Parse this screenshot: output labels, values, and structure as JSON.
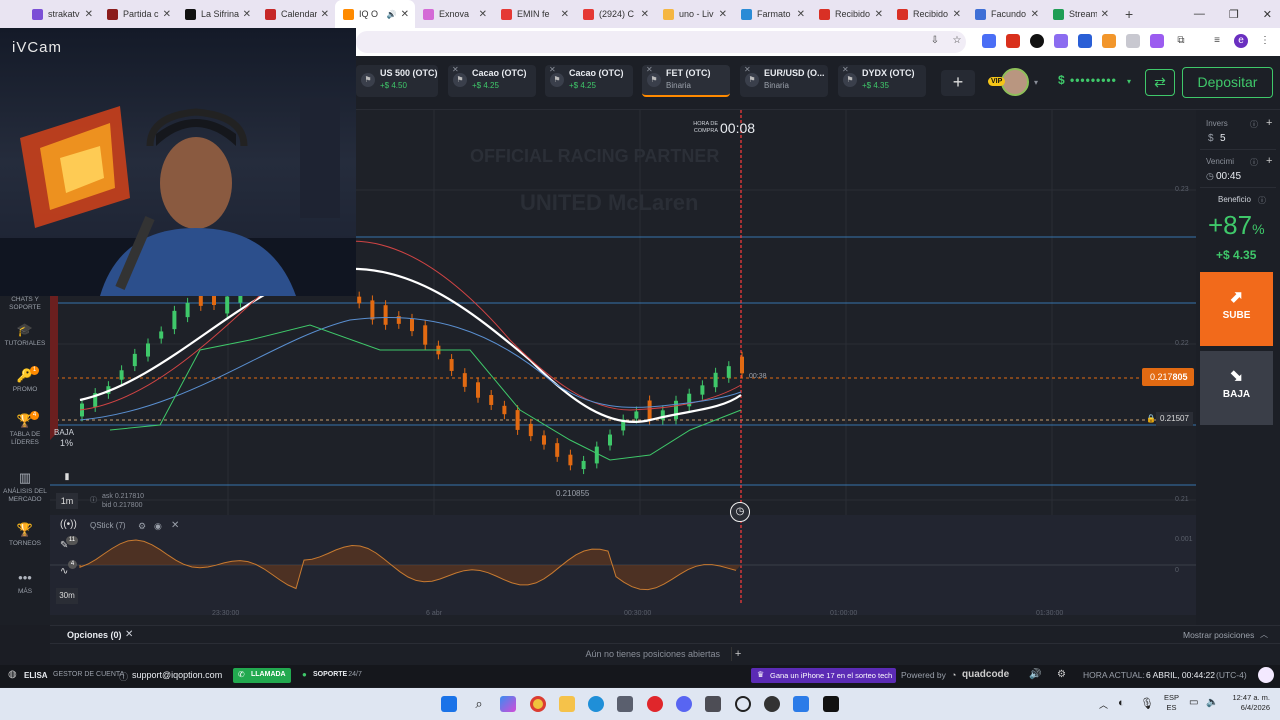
{
  "browser": {
    "tabs": [
      {
        "label": "strakatv",
        "color": "#7b4fd6"
      },
      {
        "label": "Partida c",
        "color": "#8b1c1c"
      },
      {
        "label": "La Sifrina",
        "color": "#111111"
      },
      {
        "label": "Calendar",
        "color": "#c62828"
      },
      {
        "label": "IQ O",
        "color": "#ff8a00",
        "active": true
      },
      {
        "label": "Exnova",
        "color": "#d46ad6"
      },
      {
        "label": "EMIN fe",
        "color": "#e53935"
      },
      {
        "label": "(2924) C",
        "color": "#e53935"
      },
      {
        "label": "uno - Liv",
        "color": "#f5b642"
      },
      {
        "label": "Farmato",
        "color": "#2a8bd6"
      },
      {
        "label": "Recibido",
        "color": "#d93025"
      },
      {
        "label": "Recibido",
        "color": "#d93025"
      },
      {
        "label": "Facundo",
        "color": "#3f6fd6"
      },
      {
        "label": "Stream",
        "color": "#1f9d55"
      }
    ],
    "new_tab": "+"
  },
  "webcam": {
    "title": "iVCam"
  },
  "assets": [
    {
      "name": "US 500 (OTC)",
      "sub": "+$ 4.50"
    },
    {
      "name": "Cacao (OTC)",
      "sub": "+$ 4.25"
    },
    {
      "name": "Cacao (OTC)",
      "sub": "+$ 4.25"
    },
    {
      "name": "FET (OTC)",
      "sub": "Binaria",
      "selected": true
    },
    {
      "name": "EUR/USD (O...",
      "sub": "Binaria"
    },
    {
      "name": "DYDX (OTC)",
      "sub": "+$ 4.35"
    }
  ],
  "header": {
    "vip": "VIP",
    "balance": "$ •••••••••",
    "deposit_label": "Depositar"
  },
  "sidebar": {
    "items": [
      {
        "label": "CHATS Y SOPORTE",
        "icon": "chat-icon"
      },
      {
        "label": "TUTORIALES",
        "icon": "graduation-cap-icon"
      },
      {
        "label": "PROMO",
        "icon": "promo-icon",
        "badge": "1"
      },
      {
        "label": "TABLA DE LÍDERES",
        "icon": "leaderboard-icon",
        "badge": "4"
      },
      {
        "label": "ANÁLISIS DEL MERCADO",
        "icon": "market-analysis-icon"
      },
      {
        "label": "TORNEOS",
        "icon": "trophy-icon"
      },
      {
        "label": "MÁS",
        "icon": "more-icon"
      }
    ]
  },
  "chart": {
    "purchase_time_label": "HORA DE COMPRA",
    "purchase_timer": "00:08",
    "expiry_timer": "00:38",
    "current_price_prefix": "0.217",
    "current_price_suffix": "805",
    "strike_price": "0.21507",
    "low_label": "0.210855",
    "ask": "ask 0.217810",
    "bid": "bid 0.217800",
    "baja_label": "BAJA",
    "baja_pct": "1%",
    "timeframe": "1m",
    "timeframe2": "30m",
    "indicator": "QStick (7)",
    "indicator_badge": "11",
    "indicator_badge2": "4",
    "right_axis": [
      "0.23",
      "0.22",
      "0.21",
      "0.001",
      "0"
    ],
    "x_axis": [
      "23:30:00",
      "6 abr",
      "00:30:00",
      "01:00:00",
      "01:30:00"
    ]
  },
  "rpanel": {
    "inversion_label": "Invers",
    "inversion_currency": "$",
    "inversion_value": "5",
    "vencimiento_label": "Vencimi",
    "vencimiento_value": "00:45",
    "beneficio_label": "Beneficio",
    "beneficio_pct": "+87",
    "beneficio_pct_suffix": "%",
    "beneficio_amount": "+$ 4.35",
    "sube_label": "SUBE",
    "baja_label": "BAJA"
  },
  "bottom": {
    "opciones_label": "Opciones (0)",
    "mostrar_label": "Mostrar posiciones",
    "empty_text": "Aún no tienes posiciones abiertas",
    "add": "+"
  },
  "status": {
    "user": "ELISA",
    "manager": "GESTOR DE CUENTA",
    "email": "support@iqoption.com",
    "llamada": "LLAMADA",
    "soporte": "SOPORTE",
    "soporte_hours": "· 24/7",
    "promo": "Gana un iPhone 17 en el sorteo tech",
    "powered": "Powered by",
    "brand": "quadcode",
    "time_label": "HORA ACTUAL:",
    "time_value": "6 ABRIL, 00:44:22",
    "tz": "(UTC-4)"
  },
  "taskbar": {
    "lang": "ESP",
    "lang2": "ES",
    "clock": "12:47 a. m.",
    "date": "6/4/2026"
  }
}
